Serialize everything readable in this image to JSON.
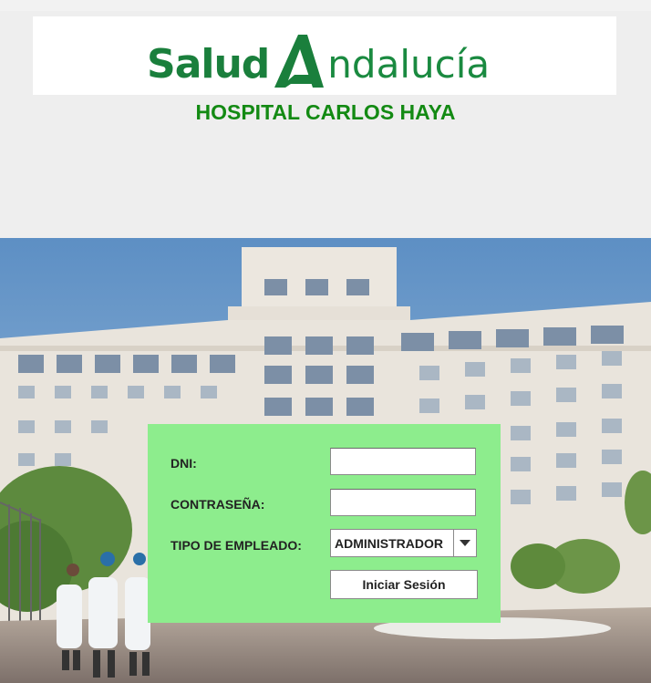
{
  "brand": {
    "logo_part1": "Salud",
    "logo_part2": "ndalucía",
    "logo_color": "#1a7f3c"
  },
  "hospital": {
    "title": "HOSPITAL CARLOS HAYA",
    "title_color": "#138a13"
  },
  "login": {
    "panel_color": "#8ded8d",
    "dni_label": "DNI:",
    "dni_value": "",
    "password_label": "CONTRASEÑA:",
    "password_value": "",
    "employee_type_label": "TIPO DE EMPLEADO:",
    "employee_type_selected": "ADMINISTRADOR",
    "submit_label": "Iniciar Sesión"
  },
  "icons": {
    "dropdown": "chevron-down-icon",
    "logo_mark": "stylized-a-logo-icon"
  }
}
